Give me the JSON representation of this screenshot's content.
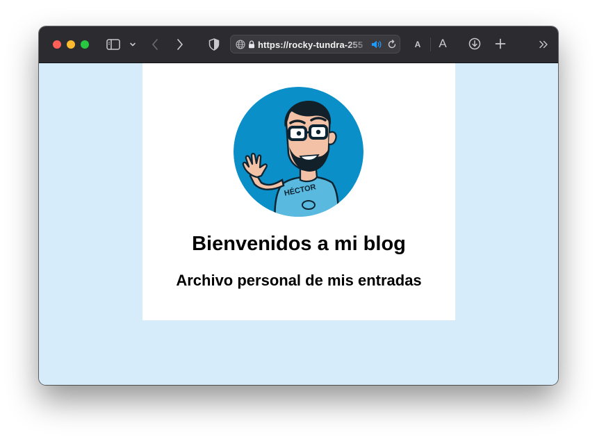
{
  "browser": {
    "url": "https://rocky-tundra-255",
    "reader_small_label": "A",
    "reader_large_label": "A"
  },
  "page": {
    "title": "Bienvenidos a mi blog",
    "subtitle": "Archivo personal de mis entradas",
    "avatar_shirt_text": "HÉCTOR"
  },
  "colors": {
    "page_background": "#d6ecfb",
    "card_background": "#ffffff",
    "avatar_background": "#0a8fc9",
    "toolbar": "#2c2b30",
    "speaker_icon": "#1e9bff"
  },
  "icons": [
    "sidebar-icon",
    "chevron-down-icon",
    "back-icon",
    "forward-icon",
    "shield-icon",
    "globe-icon",
    "lock-icon",
    "speaker-icon",
    "reload-icon",
    "download-icon",
    "plus-icon",
    "double-chevron-icon"
  ]
}
